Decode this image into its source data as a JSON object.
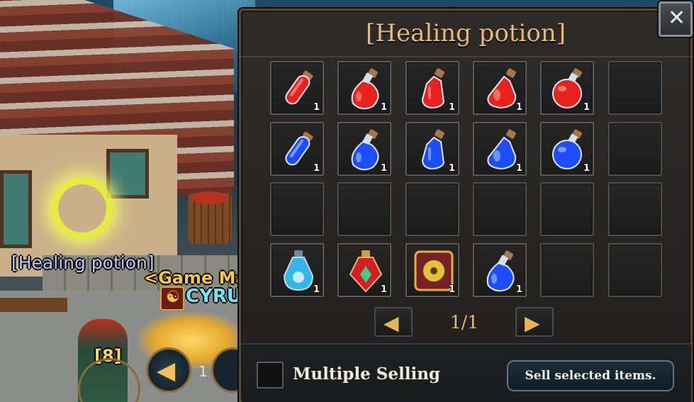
{
  "world": {
    "item_label": "[Healing potion]",
    "guild_title": "<Game Ma",
    "player_name": "CYRU",
    "npc_level": "[8]",
    "hud_number": "1"
  },
  "panel": {
    "title": "[Healing potion]",
    "close_icon": "close-icon",
    "page_indicator": "1/1",
    "multiple_selling_label": "Multiple Selling",
    "multiple_selling_checked": false,
    "sell_button_label": "Sell selected items.",
    "prev_icon": "arrow-left-icon",
    "next_icon": "arrow-right-icon"
  },
  "inventory": {
    "rows": [
      [
        {
          "item": "red-vial-potion",
          "qty": "1"
        },
        {
          "item": "red-flask-potion",
          "qty": "1"
        },
        {
          "item": "red-bottle-potion",
          "qty": "1"
        },
        {
          "item": "red-large-flask-potion",
          "qty": "1"
        },
        {
          "item": "red-round-flask-potion",
          "qty": "1"
        },
        {
          "item": "",
          "qty": ""
        }
      ],
      [
        {
          "item": "blue-vial-potion",
          "qty": "1"
        },
        {
          "item": "blue-flask-potion",
          "qty": "1"
        },
        {
          "item": "blue-bottle-potion",
          "qty": "1"
        },
        {
          "item": "blue-large-flask-potion",
          "qty": "1"
        },
        {
          "item": "blue-round-flask-potion",
          "qty": "1"
        },
        {
          "item": "",
          "qty": ""
        }
      ],
      [
        {
          "item": "",
          "qty": ""
        },
        {
          "item": "",
          "qty": ""
        },
        {
          "item": "",
          "qty": ""
        },
        {
          "item": "",
          "qty": ""
        },
        {
          "item": "",
          "qty": ""
        },
        {
          "item": "",
          "qty": ""
        }
      ],
      [
        {
          "item": "ornate-blue-elixir",
          "qty": "1"
        },
        {
          "item": "ornate-red-elixir",
          "qty": "1"
        },
        {
          "item": "golden-emblem-item",
          "qty": "1"
        },
        {
          "item": "blue-shield-flask",
          "qty": "1"
        },
        {
          "item": "",
          "qty": ""
        },
        {
          "item": "",
          "qty": ""
        }
      ]
    ]
  },
  "colors": {
    "title": "#e7b878",
    "red_liquid": "#e8231f",
    "blue_liquid": "#1e4dff",
    "panel_bg": "#2e2b29",
    "sell_button_border": "#5d7481"
  }
}
